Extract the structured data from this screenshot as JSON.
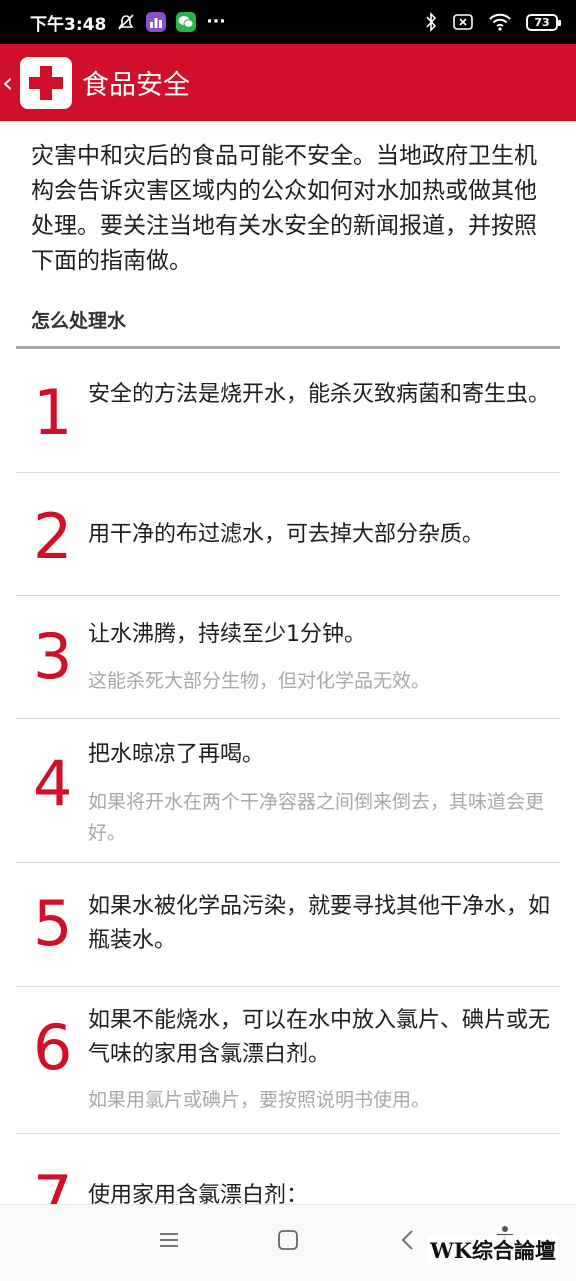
{
  "status_bar": {
    "time": "下午3:48",
    "more": "···",
    "battery": "73",
    "icons": [
      "mute-icon",
      "app-icon",
      "wechat-icon",
      "bluetooth-icon",
      "sim-icon",
      "wifi-icon",
      "battery-icon"
    ]
  },
  "header": {
    "back": "‹",
    "title": "食品安全",
    "brand_color": "#d0102b"
  },
  "intro": "灾害中和灾后的食品可能不安全。当地政府卫生机构会告诉灾害区域内的公众如何对水加热或做其他处理。要关注当地有关水安全的新闻报道，并按照下面的指南做。",
  "section": {
    "title": "怎么处理水"
  },
  "steps": [
    {
      "num": "1",
      "text": "安全的方法是烧开水，能杀灭致病菌和寄生虫。",
      "note": ""
    },
    {
      "num": "2",
      "text": "用干净的布过滤水，可去掉大部分杂质。",
      "note": ""
    },
    {
      "num": "3",
      "text": "让水沸腾，持续至少1分钟。",
      "note": "这能杀死大部分生物，但对化学品无效。"
    },
    {
      "num": "4",
      "text": "把水晾凉了再喝。",
      "note": "如果将开水在两个干净容器之间倒来倒去，其味道会更好。"
    },
    {
      "num": "5",
      "text": "如果水被化学品污染，就要寻找其他干净水，如瓶装水。",
      "note": ""
    },
    {
      "num": "6",
      "text": "如果不能烧水，可以在水中放入氯片、碘片或无气味的家用含氯漂白剂。",
      "note": "如果用氯片或碘片，要按照说明书使用。"
    },
    {
      "num": "7",
      "text": "使用家用含氯漂白剂：",
      "note": ""
    }
  ],
  "watermark": "WK综合論壇"
}
